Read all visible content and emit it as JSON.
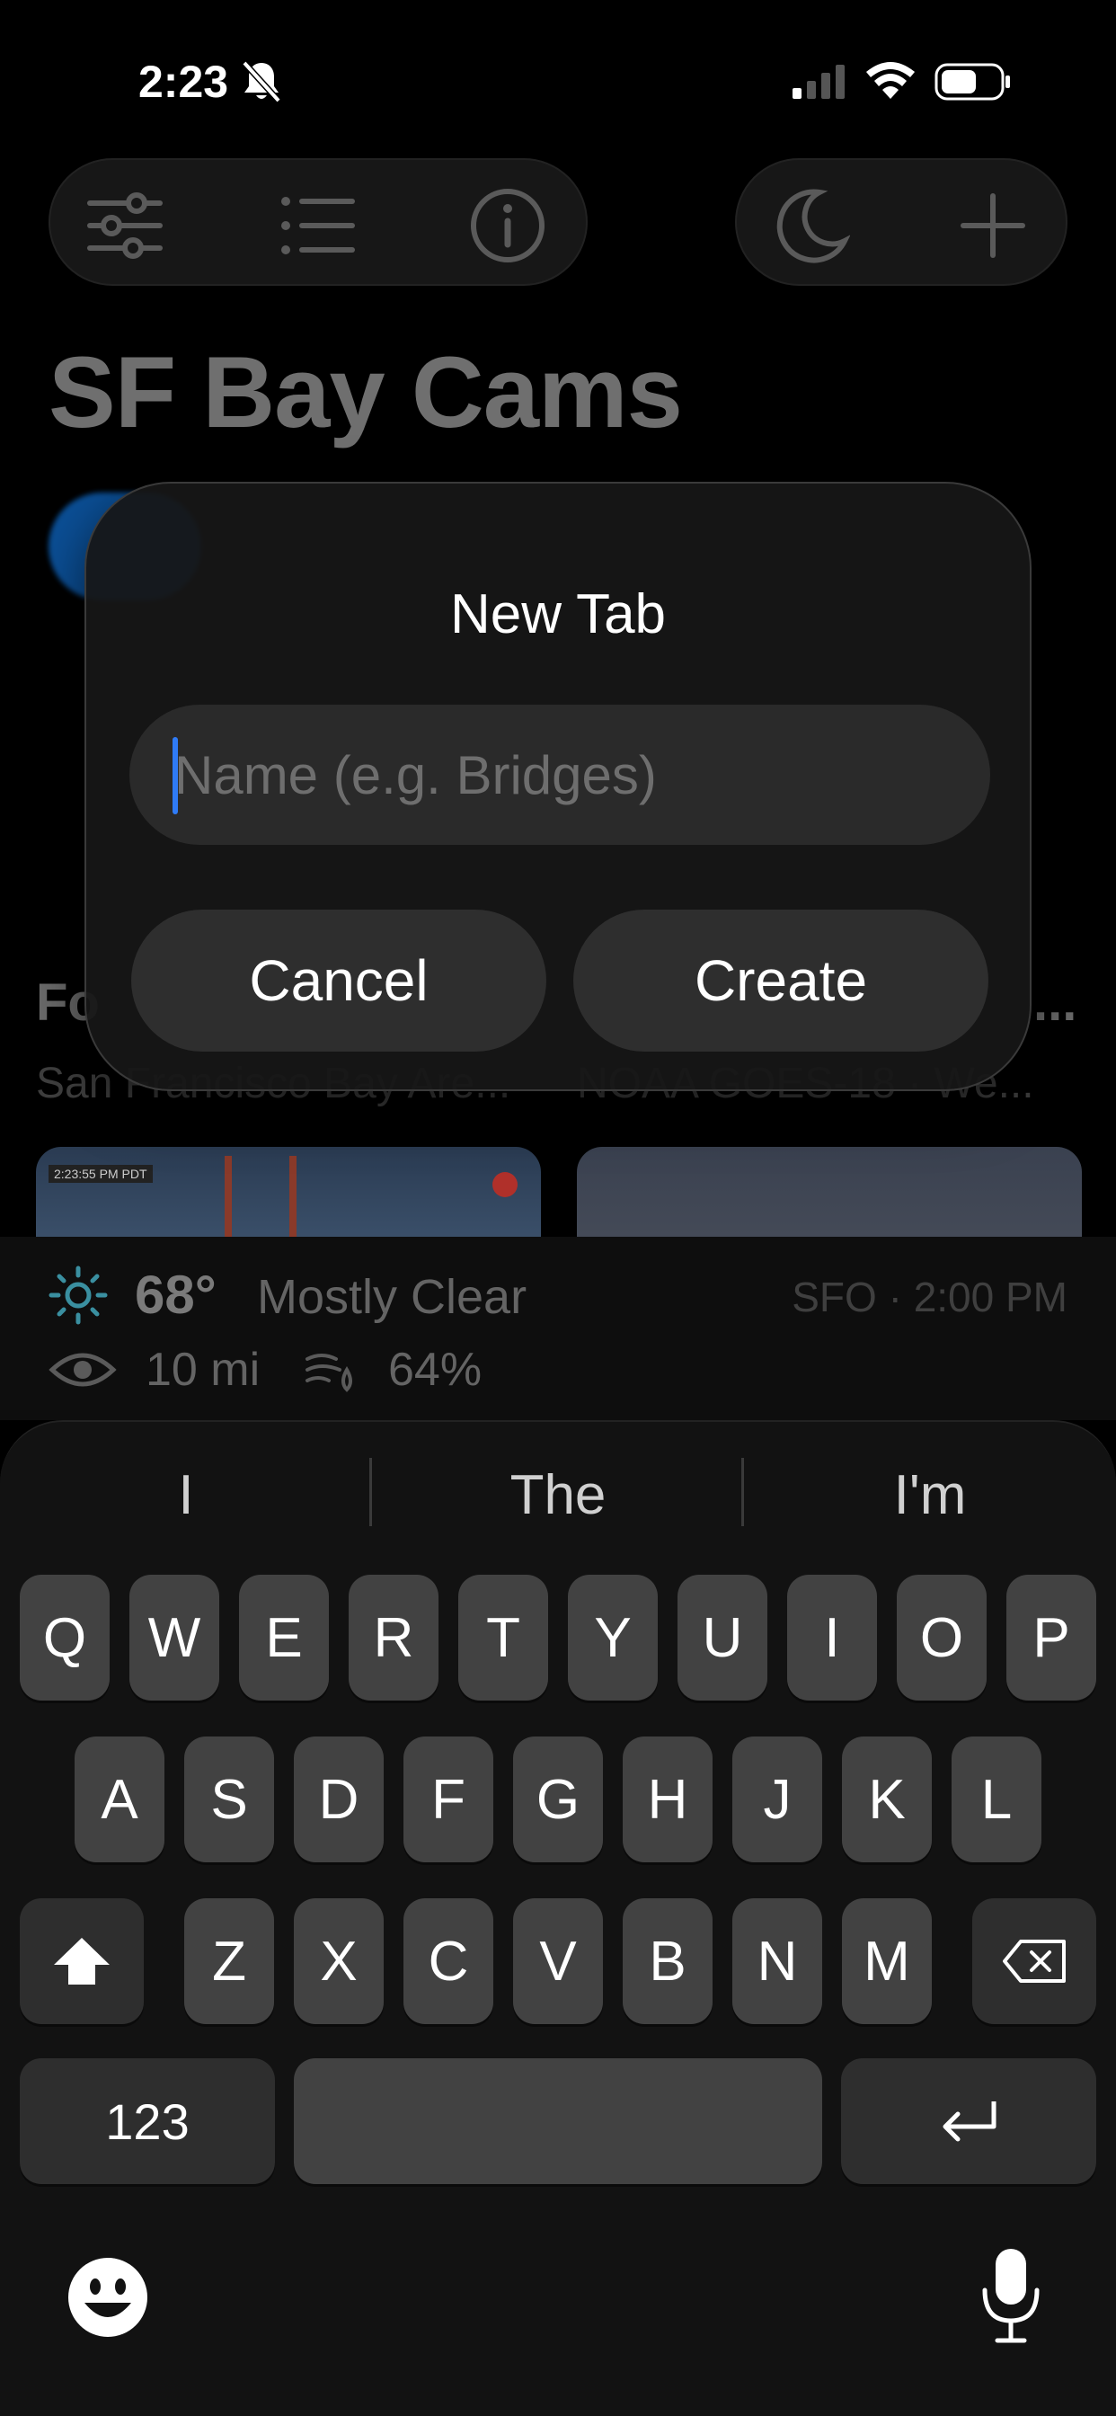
{
  "status_bar": {
    "time": "2:23",
    "icons": [
      "bell-slash-icon",
      "cellular-signal-icon",
      "wifi-icon",
      "battery-icon"
    ]
  },
  "toolbar": {
    "left_icons": [
      "sliders-icon",
      "list-icon",
      "info-icon"
    ],
    "right_icons": [
      "moon-icon",
      "plus-icon"
    ]
  },
  "app": {
    "title": "SF Bay Cams"
  },
  "background_section": {
    "heading_partial": "Fo",
    "heading_right_partial": "...",
    "left_subtitle": "San Francisco Bay Are...",
    "right_subtitle": "NOAA GOES-18 · We..."
  },
  "camera": {
    "timestamp": "2:23:55 PM PDT"
  },
  "weather": {
    "temperature": "68°",
    "condition": "Mostly Clear",
    "station": "SFO · 2:00 PM",
    "visibility": "10 mi",
    "humidity": "64%"
  },
  "dialog": {
    "title": "New Tab",
    "input_placeholder": "Name (e.g. Bridges)",
    "input_value": "",
    "cancel_label": "Cancel",
    "create_label": "Create"
  },
  "keyboard": {
    "suggestions": [
      "I",
      "The",
      "I'm"
    ],
    "row1": [
      "Q",
      "W",
      "E",
      "R",
      "T",
      "Y",
      "U",
      "I",
      "O",
      "P"
    ],
    "row2": [
      "A",
      "S",
      "D",
      "F",
      "G",
      "H",
      "J",
      "K",
      "L"
    ],
    "row3": [
      "Z",
      "X",
      "C",
      "V",
      "B",
      "N",
      "M"
    ],
    "numbers_label": "123",
    "space_label": ""
  }
}
